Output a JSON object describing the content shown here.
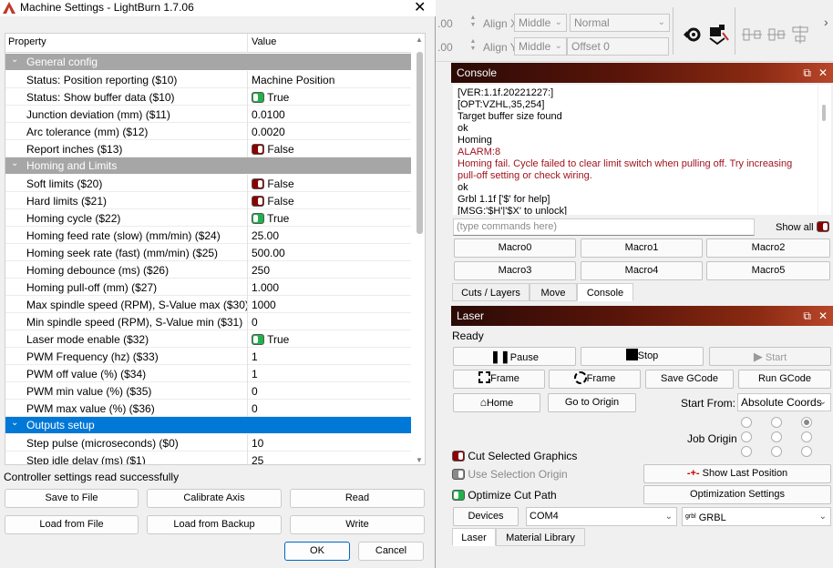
{
  "dialog": {
    "title": "Machine Settings - LightBurn 1.7.06",
    "columns": [
      "Property",
      "Value"
    ],
    "rows": [
      {
        "type": "group",
        "label": "General config"
      },
      {
        "type": "row",
        "property": "Status: Position reporting ($10)",
        "value": "Machine Position"
      },
      {
        "type": "row",
        "property": "Status: Show buffer data ($10)",
        "value": "True",
        "toggle": "green"
      },
      {
        "type": "row",
        "property": "Junction deviation (mm) ($11)",
        "value": "0.0100"
      },
      {
        "type": "row",
        "property": "Arc tolerance (mm) ($12)",
        "value": "0.0020"
      },
      {
        "type": "row",
        "property": "Report inches ($13)",
        "value": "False",
        "toggle": "red"
      },
      {
        "type": "group",
        "label": "Homing and Limits"
      },
      {
        "type": "row",
        "property": "Soft limits ($20)",
        "value": "False",
        "toggle": "red"
      },
      {
        "type": "row",
        "property": "Hard limits ($21)",
        "value": "False",
        "toggle": "red"
      },
      {
        "type": "row",
        "property": "Homing cycle ($22)",
        "value": "True",
        "toggle": "green"
      },
      {
        "type": "row",
        "property": "Homing feed rate (slow) (mm/min) ($24)",
        "value": "25.00"
      },
      {
        "type": "row",
        "property": "Homing seek rate (fast) (mm/min) ($25)",
        "value": "500.00"
      },
      {
        "type": "row",
        "property": "Homing debounce (ms) ($26)",
        "value": "250"
      },
      {
        "type": "row",
        "property": "Homing pull-off (mm) ($27)",
        "value": "1.000"
      },
      {
        "type": "row",
        "property": "Max spindle speed (RPM), S-Value max ($30)",
        "value": "1000"
      },
      {
        "type": "row",
        "property": "Min spindle speed (RPM), S-Value min ($31)",
        "value": "0"
      },
      {
        "type": "row",
        "property": "Laser mode enable ($32)",
        "value": "True",
        "toggle": "green"
      },
      {
        "type": "row",
        "property": "PWM Frequency (hz) ($33)",
        "value": "1"
      },
      {
        "type": "row",
        "property": "PWM off value (%) ($34)",
        "value": "1"
      },
      {
        "type": "row",
        "property": "PWM min value (%) ($35)",
        "value": "0"
      },
      {
        "type": "row",
        "property": "PWM max value (%) ($36)",
        "value": "0"
      },
      {
        "type": "group",
        "label": "Outputs setup",
        "selected": true
      },
      {
        "type": "row",
        "property": "Step pulse (microseconds) ($0)",
        "value": "10"
      },
      {
        "type": "row",
        "property": "Step idle delay (ms) ($1)",
        "value": "25"
      }
    ],
    "status": "Controller settings read successfully",
    "buttons": {
      "save_to_file": "Save to File",
      "calibrate_axis": "Calibrate Axis",
      "read": "Read",
      "load_from_file": "Load from File",
      "load_from_backup": "Load from Backup",
      "write": "Write",
      "ok": "OK",
      "cancel": "Cancel"
    }
  },
  "toolbar": {
    "field1": ".00",
    "field2": ".00",
    "align_x_label": "Align X",
    "align_x_value": "Middle",
    "align_y_label": "Align Y",
    "align_y_value": "Middle",
    "blend_value": "Normal",
    "offset_label": "Offset",
    "offset_value": "0"
  },
  "console": {
    "title": "Console",
    "lines": [
      {
        "text": "[VER:1.1f.20221227:]",
        "err": false
      },
      {
        "text": "[OPT:VZHL,35,254]",
        "err": false
      },
      {
        "text": "Target buffer size found",
        "err": false
      },
      {
        "text": "ok",
        "err": false
      },
      {
        "text": "Homing",
        "err": false
      },
      {
        "text": "ALARM:8",
        "err": true
      },
      {
        "text": "Homing fail. Cycle failed to clear limit switch when pulling off. Try increasing pull-off setting or check wiring.",
        "err": true
      },
      {
        "text": "ok",
        "err": false
      },
      {
        "text": "Grbl 1.1f ['$' for help]",
        "err": false
      },
      {
        "text": "[MSG:'$H'|'$X' to unlock]",
        "err": false
      }
    ],
    "command_placeholder": "(type commands here)",
    "show_all": "Show all",
    "macros": [
      "Macro0",
      "Macro1",
      "Macro2",
      "Macro3",
      "Macro4",
      "Macro5"
    ],
    "tabs": [
      "Cuts / Layers",
      "Move",
      "Console"
    ]
  },
  "laser": {
    "title": "Laser",
    "state": "Ready",
    "pause": "Pause",
    "stop": "Stop",
    "start": "Start",
    "frame1": "Frame",
    "frame2": "Frame",
    "save_gcode": "Save GCode",
    "run_gcode": "Run GCode",
    "home": "Home",
    "go_to_origin": "Go to Origin",
    "start_from_label": "Start From:",
    "start_from_value": "Absolute Coords",
    "job_origin_label": "Job Origin",
    "cut_selected": "Cut Selected Graphics",
    "use_selection_origin": "Use Selection Origin",
    "optimize_cut_path": "Optimize Cut Path",
    "show_last_position": "Show Last Position",
    "optimization_settings": "Optimization Settings",
    "devices": "Devices",
    "port": "COM4",
    "device_prefix": "grbl",
    "device": "GRBL",
    "tabs": [
      "Laser",
      "Material Library"
    ]
  }
}
